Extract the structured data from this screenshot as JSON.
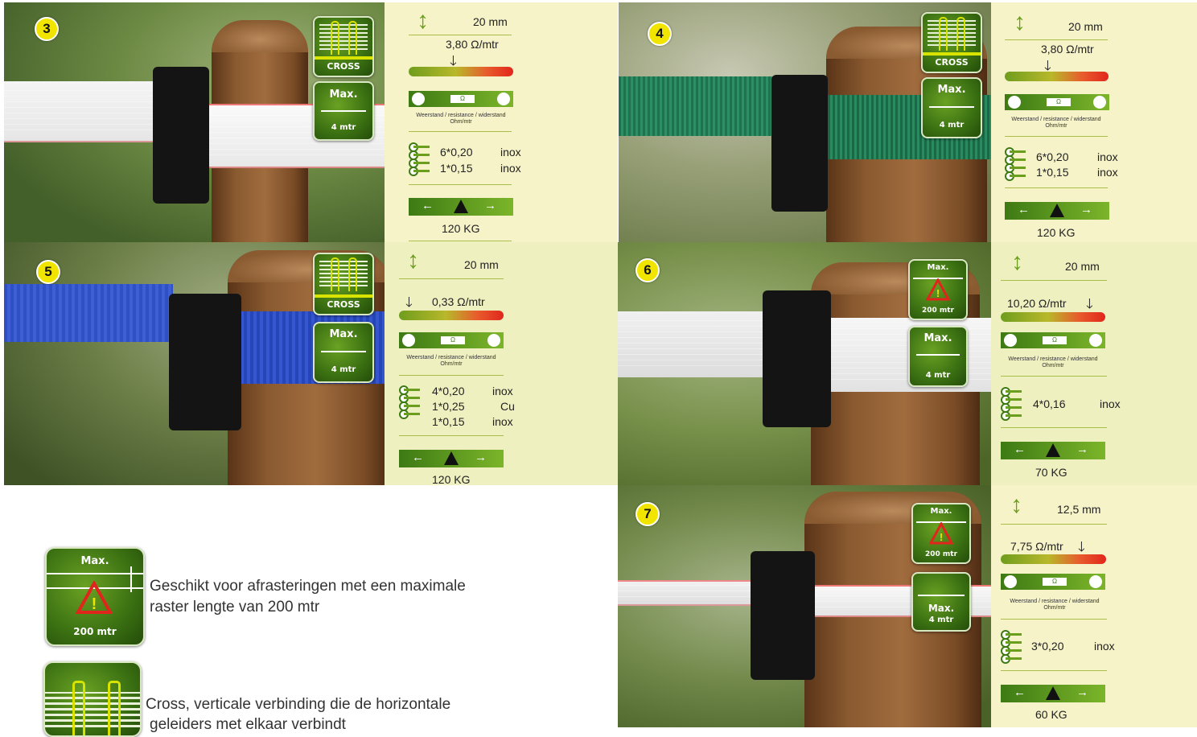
{
  "panels": [
    {
      "num": "3",
      "badge1": "CROSS",
      "badge2_top": "Max.",
      "badge2_bottom": "4 mtr",
      "width": "20 mm",
      "resistance": "3,80 Ω/mtr",
      "res_caption": "Weerstand / resistance / widerstand",
      "res_unit": "Ohm/mtr",
      "res_box": "Ω",
      "wires": [
        {
          "spec": "6*0,20",
          "mat": "inox"
        },
        {
          "spec": "1*0,15",
          "mat": "inox"
        }
      ],
      "strength": "120 KG",
      "tape_color": "white-red"
    },
    {
      "num": "4",
      "badge1": "CROSS",
      "badge2_top": "Max.",
      "badge2_bottom": "4 mtr",
      "width": "20 mm",
      "resistance": "3,80 Ω/mtr",
      "res_caption": "Weerstand / resistance / widerstand",
      "res_unit": "Ohm/mtr",
      "res_box": "Ω",
      "wires": [
        {
          "spec": "6*0,20",
          "mat": "inox"
        },
        {
          "spec": "1*0,15",
          "mat": "inox"
        }
      ],
      "strength": "120 KG",
      "tape_color": "green"
    },
    {
      "num": "5",
      "badge1": "CROSS",
      "badge2_top": "Max.",
      "badge2_bottom": "4 mtr",
      "width": "20 mm",
      "resistance": "0,33 Ω/mtr",
      "res_caption": "Weerstand / resistance / widerstand",
      "res_unit": "Ohm/mtr",
      "res_box": "Ω",
      "wires": [
        {
          "spec": "4*0,20",
          "mat": "inox"
        },
        {
          "spec": "1*0,25",
          "mat": "Cu"
        },
        {
          "spec": "1*0,15",
          "mat": "inox"
        }
      ],
      "strength": "120 KG",
      "tape_color": "blue"
    },
    {
      "num": "6",
      "badge1_top": "Max.",
      "badge1_bottom": "200 mtr",
      "badge2_top": "Max.",
      "badge2_bottom": "4 mtr",
      "width": "20 mm",
      "resistance": "10,20 Ω/mtr",
      "res_caption": "Weerstand / resistance / widerstand",
      "res_unit": "Ohm/mtr",
      "res_box": "Ω",
      "wires": [
        {
          "spec": "4*0,16",
          "mat": "inox"
        }
      ],
      "strength": "70 KG",
      "tape_color": "white"
    },
    {
      "num": "7",
      "badge1_top": "Max.",
      "badge1_bottom": "200 mtr",
      "badge2_top": "Max.",
      "badge2_bottom": "4 mtr",
      "width": "12,5 mm",
      "resistance": "7,75 Ω/mtr",
      "res_caption": "Weerstand / resistance / widerstand",
      "res_unit": "Ohm/mtr",
      "res_box": "Ω",
      "wires": [
        {
          "spec": "3*0,20",
          "mat": "inox"
        }
      ],
      "strength": "60 KG",
      "tape_color": "white-red"
    }
  ],
  "legend": {
    "max_badge_top": "Max.",
    "max_badge_bottom": "200 mtr",
    "max_text_1": "Geschikt voor afrasteringen met een maximale",
    "max_text_2": "raster lengte van 200 mtr",
    "cross_text_1": "Cross, verticale verbinding die de horizontale",
    "cross_text_2": "geleiders met elkaar verbindt"
  },
  "colors": {
    "accent_green": "#3d7a14",
    "highlight_yellow": "#f1e500",
    "panel_bg": "#f6f3c8",
    "panel_bg_alt": "#eff0c0"
  }
}
